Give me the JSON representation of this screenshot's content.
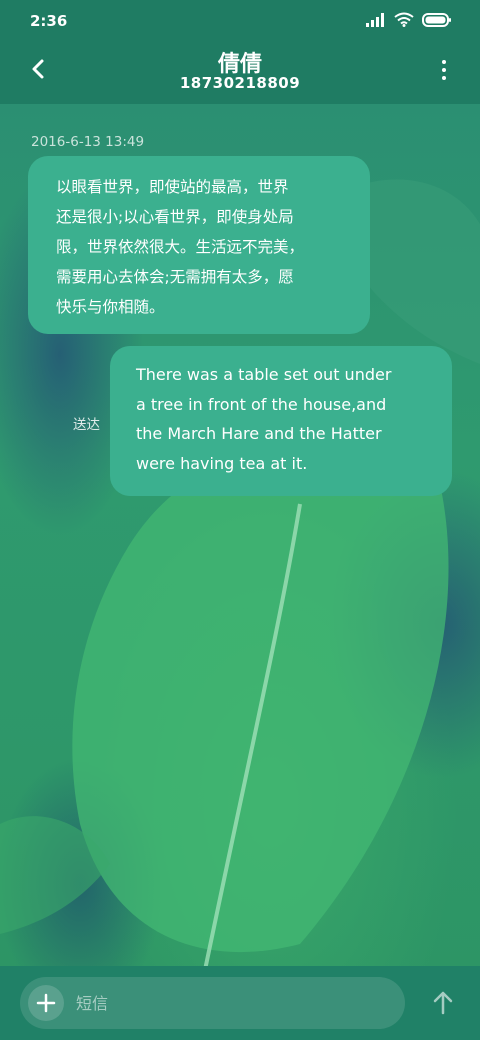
{
  "status_bar": {
    "time": "2:36",
    "icons": [
      "signal-icon",
      "wifi-icon",
      "battery-icon"
    ]
  },
  "header": {
    "contact_name": "倩倩",
    "phone_number": "18730218809",
    "back_icon": "chevron-left-icon",
    "more_icon": "more-vertical-icon"
  },
  "conversation": {
    "timestamp": "2016-6-13 13:49",
    "incoming_message": {
      "lines": [
        "以眼看世界，即使站的最高，世界",
        "还是很小;以心看世界，即使身处局",
        "限，世界依然很大。生活远不完美，",
        "需要用心去体会;无需拥有太多，愿",
        "快乐与你相随。"
      ]
    },
    "outgoing_message": {
      "lines": [
        "There was a table set out under",
        "a tree in front of the house,and",
        "the March Hare and the Hatter",
        "were having tea at it."
      ],
      "status": "送达"
    }
  },
  "composer": {
    "placeholder": "短信",
    "value": "",
    "add_icon": "plus-icon",
    "send_icon": "arrow-up-icon"
  },
  "colors": {
    "header_bg": "#1f7c63",
    "bubble_bg": "#3bb08f",
    "bottom_bar_bg": "#208167"
  }
}
